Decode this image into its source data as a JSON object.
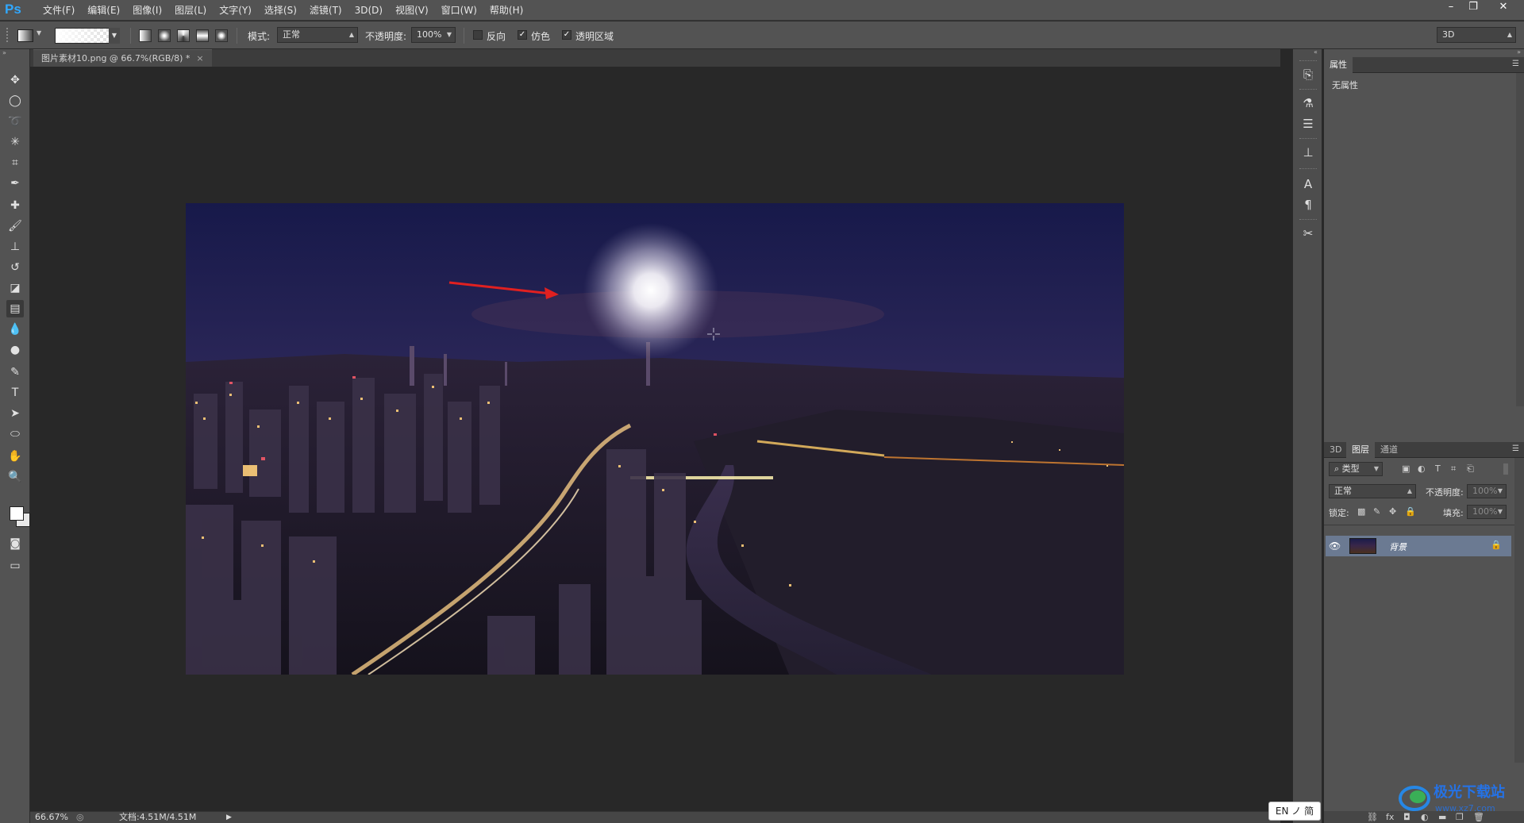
{
  "app": {
    "logo": "Ps",
    "menu": [
      "文件(F)",
      "编辑(E)",
      "图像(I)",
      "图层(L)",
      "文字(Y)",
      "选择(S)",
      "滤镜(T)",
      "3D(D)",
      "视图(V)",
      "窗口(W)",
      "帮助(H)"
    ],
    "window_controls": {
      "minimize": "–",
      "restore": "❐",
      "close": "✕"
    }
  },
  "options": {
    "mode_label": "模式:",
    "mode_value": "正常",
    "opacity_label": "不透明度:",
    "opacity_value": "100%",
    "reverse_label": "反向",
    "reverse_checked": false,
    "dither_label": "仿色",
    "dither_checked": true,
    "transparency_label": "透明区域",
    "transparency_checked": true,
    "workspace": "3D"
  },
  "document": {
    "tab_title": "图片素材10.png @ 66.7%(RGB/8) *",
    "zoom": "66.67%",
    "doc_info": "文档:4.51M/4.51M"
  },
  "properties": {
    "tab": "属性",
    "content": "无属性"
  },
  "layers": {
    "tabs": [
      "3D",
      "图层",
      "通道"
    ],
    "active_tab": "图层",
    "filter_type": "类型",
    "blend_mode": "正常",
    "opacity_label": "不透明度:",
    "opacity_value": "100%",
    "lock_label": "锁定:",
    "fill_label": "填充:",
    "fill_value": "100%",
    "items": [
      {
        "name": "背景",
        "visible": true,
        "locked": true
      }
    ]
  },
  "ime": {
    "text": "EN ノ 简"
  },
  "watermark": {
    "text": "极光下载站",
    "url_text": "www.xz7.com"
  },
  "colors": {
    "ui_dark": "#535353",
    "canvas_bg": "#282828",
    "accent_ps": "#31a8ff",
    "arrow_red": "#e02020",
    "layer_selected": "#6b7a92"
  }
}
